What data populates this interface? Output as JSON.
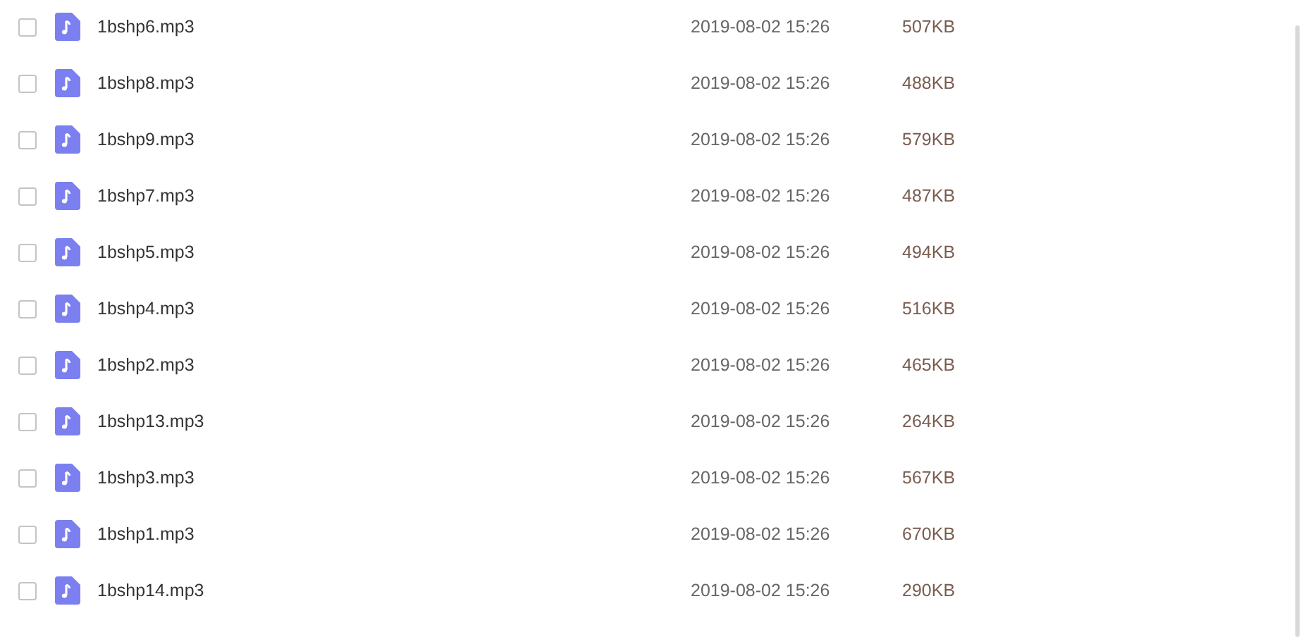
{
  "files": [
    {
      "name": "1bshp6.mp3",
      "modified": "2019-08-02 15:26",
      "size": "507KB",
      "checked": false
    },
    {
      "name": "1bshp8.mp3",
      "modified": "2019-08-02 15:26",
      "size": "488KB",
      "checked": false
    },
    {
      "name": "1bshp9.mp3",
      "modified": "2019-08-02 15:26",
      "size": "579KB",
      "checked": false
    },
    {
      "name": "1bshp7.mp3",
      "modified": "2019-08-02 15:26",
      "size": "487KB",
      "checked": false
    },
    {
      "name": "1bshp5.mp3",
      "modified": "2019-08-02 15:26",
      "size": "494KB",
      "checked": false
    },
    {
      "name": "1bshp4.mp3",
      "modified": "2019-08-02 15:26",
      "size": "516KB",
      "checked": false
    },
    {
      "name": "1bshp2.mp3",
      "modified": "2019-08-02 15:26",
      "size": "465KB",
      "checked": false
    },
    {
      "name": "1bshp13.mp3",
      "modified": "2019-08-02 15:26",
      "size": "264KB",
      "checked": false
    },
    {
      "name": "1bshp3.mp3",
      "modified": "2019-08-02 15:26",
      "size": "567KB",
      "checked": false
    },
    {
      "name": "1bshp1.mp3",
      "modified": "2019-08-02 15:26",
      "size": "670KB",
      "checked": false
    },
    {
      "name": "1bshp14.mp3",
      "modified": "2019-08-02 15:26",
      "size": "290KB",
      "checked": false
    }
  ]
}
